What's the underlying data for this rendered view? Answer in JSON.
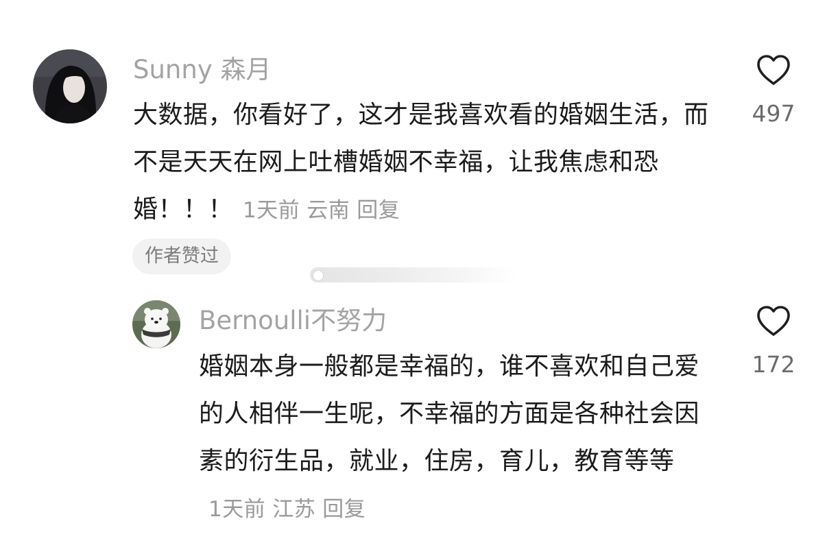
{
  "comments": [
    {
      "username": "Sunny 森月",
      "text": "大数据，你看好了，这才是我喜欢看的婚姻生活，而不是天天在网上吐槽婚姻不幸福，让我焦虑和恐婚！！！",
      "time": "1天前",
      "location": "云南",
      "reply_label": "回复",
      "likes": "497",
      "badge": "作者赞过"
    },
    {
      "username": "Bernoulli不努力",
      "text": "婚姻本身一般都是幸福的，谁不喜欢和自己爱的人相伴一生呢，不幸福的方面是各种社会因素的衍生品，就业，住房，育儿，教育等等",
      "time": "1天前",
      "location": "江苏",
      "reply_label": "回复",
      "likes": "172"
    }
  ],
  "icons": {
    "like": "heart-outline-icon",
    "avatar1": "avatar-woman-dark-hair",
    "avatar2": "avatar-white-bear"
  },
  "colors": {
    "username": "#a3a3a3",
    "body_text": "#1b1b1b",
    "meta": "#9a9a9a",
    "badge_bg": "#f2f2f2"
  }
}
